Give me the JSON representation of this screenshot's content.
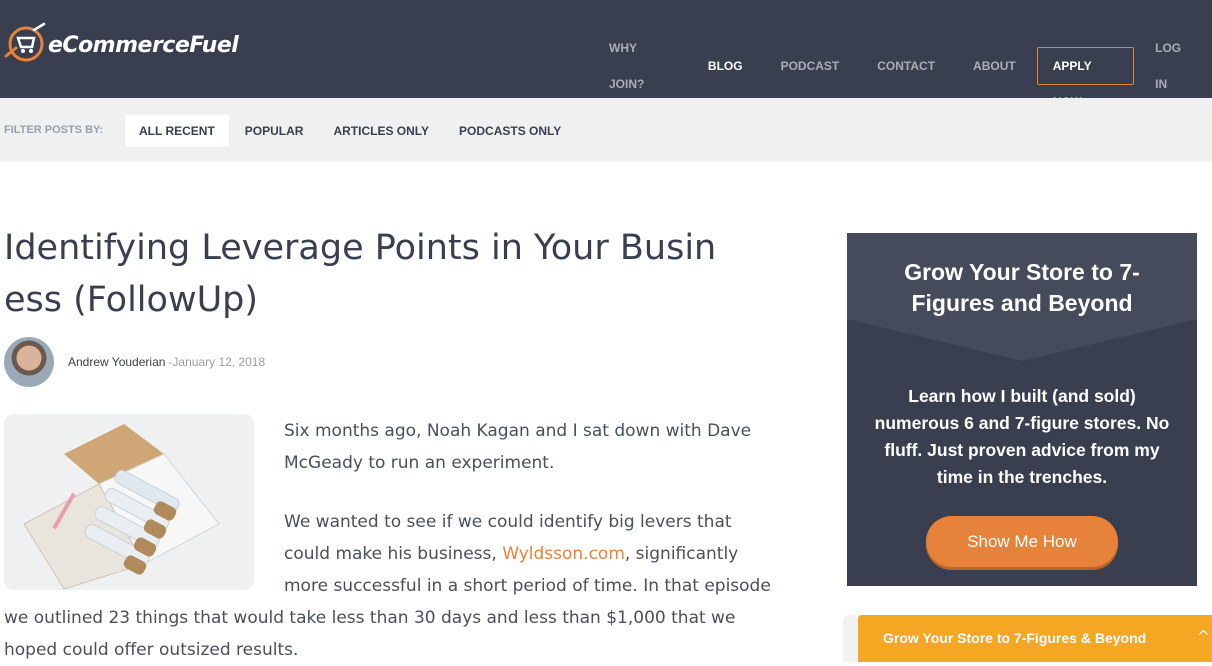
{
  "header": {
    "logo_text": "eCommerceFuel",
    "nav": [
      {
        "label": "WHY JOIN?"
      },
      {
        "label": "BLOG"
      },
      {
        "label": "PODCAST"
      },
      {
        "label": "CONTACT"
      },
      {
        "label": "ABOUT"
      },
      {
        "label": "APPLY NOW"
      },
      {
        "label": "LOG IN"
      }
    ],
    "active_nav": "BLOG",
    "accent_color": "#e6823a",
    "bg_color": "#3a3f4f"
  },
  "filters": {
    "label": "FILTER POSTS BY:",
    "tabs": [
      {
        "label": "ALL RECENT"
      },
      {
        "label": "POPULAR"
      },
      {
        "label": "ARTICLES ONLY"
      },
      {
        "label": "PODCASTS ONLY"
      }
    ],
    "active_tab": "ALL RECENT"
  },
  "article": {
    "title_line1": "Identifying Leverage Points in Your Busin",
    "title_line2": "ess (FollowUp)",
    "author": "Andrew Youderian",
    "date": "-January 12, 2018",
    "image_icon": "product-box-image",
    "p1_line1": "Six months ago, Noah Kagan and I sat down with Dave",
    "p1_line2": "McGeady to run an experiment.",
    "p2_line1": "We wanted to see if we could identify big levers that",
    "p2_line2_before": "could make his business, ",
    "p2_link": "Wyldsson.com",
    "p2_line2_after": ", significantly",
    "p2_line3": "more successful in a short period of time. In that episode",
    "p2_line4": "we outlined 23 things that would take less than 30 days and less than $1,000 that we",
    "p2_line5": "hoped could offer outsized results."
  },
  "sidebar": {
    "heading": "Grow Your Store to 7-Figures and Beyond",
    "body": "Learn how I built (and sold) numerous 6 and 7-figure stores. No fluff. Just proven advice from my time in the trenches.",
    "button": "Show Me How"
  },
  "sticky": {
    "label": "Grow Your Store to 7-Figures & Beyond",
    "caret_icon": "chevron-up-icon"
  }
}
